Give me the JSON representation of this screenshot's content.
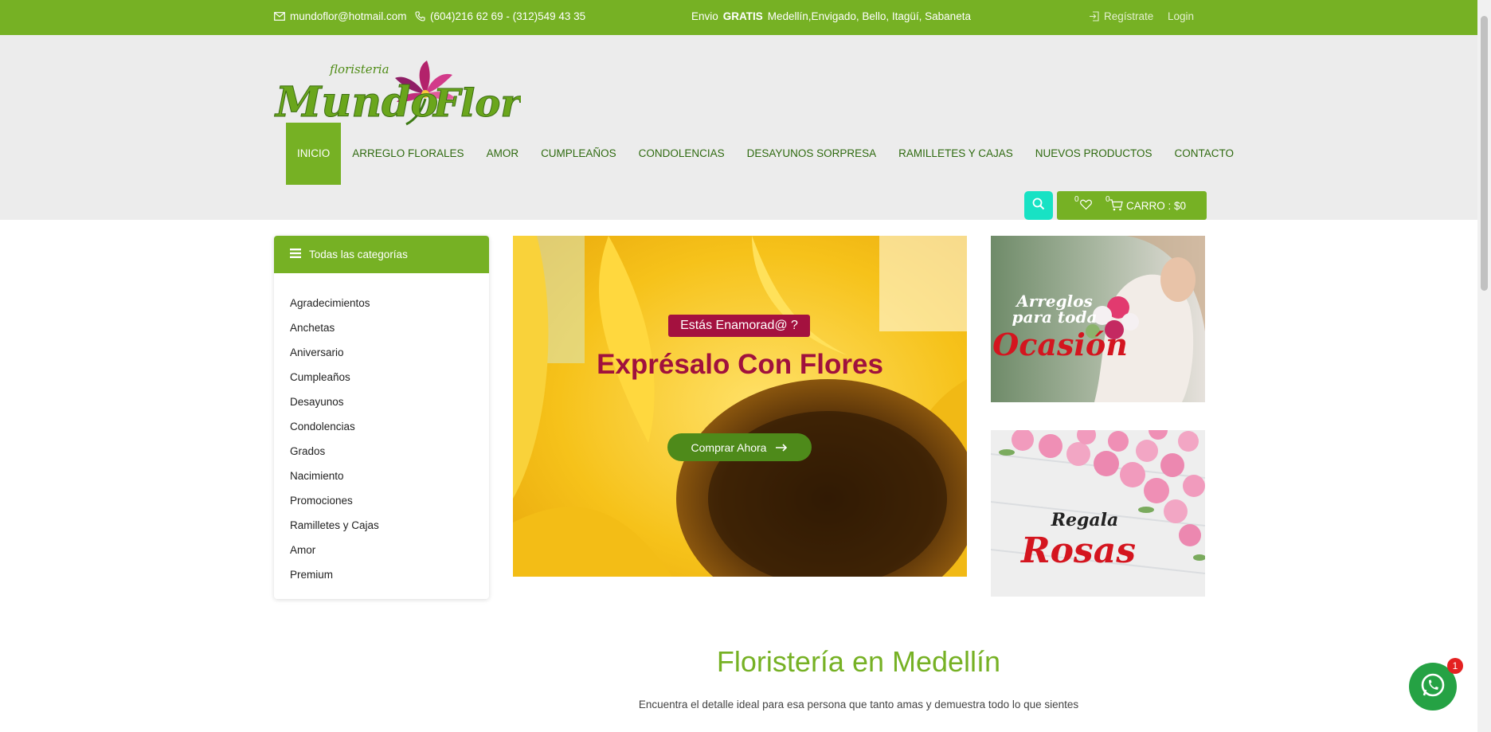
{
  "topbar": {
    "email": "mundoflor@hotmail.com",
    "phone": "(604)216 62 69 - (312)549 43 35",
    "promo_prefix": "Envio",
    "promo_bold": "GRATIS",
    "promo_rest": "Medellín,Envigado, Bello, Itagüí, Sabaneta",
    "register": "Regístrate",
    "login": "Login"
  },
  "logo": {
    "small_text": "floristeria",
    "main_text": "Mundo Flor"
  },
  "nav": {
    "items": [
      "INICIO",
      "ARREGLO FLORALES",
      "AMOR",
      "CUMPLEAÑOS",
      "CONDOLENCIAS",
      "DESAYUNOS SORPRESA",
      "RAMILLETES Y CAJAS",
      "NUEVOS PRODUCTOS",
      "CONTACTO"
    ],
    "active": "INICIO"
  },
  "cart": {
    "wishlist_count": "0",
    "cart_count": "0",
    "label": "CARRO : $0"
  },
  "sidebar": {
    "title": "Todas las categorías",
    "categories": [
      "Agradecimientos",
      "Anchetas",
      "Aniversario",
      "Cumpleaños",
      "Desayunos",
      "Condolencias",
      "Grados",
      "Nacimiento",
      "Promociones",
      "Ramilletes y Cajas",
      "Amor",
      "Premium"
    ]
  },
  "hero": {
    "tag": "Estás Enamorad@ ?",
    "title": "Exprésalo Con Flores",
    "cta": "Comprar Ahora"
  },
  "banners": {
    "top_line1": "Arreglos",
    "top_line2": "para toda",
    "top_line3": "Ocasión",
    "bottom_line1": "Regala",
    "bottom_line2": "Rosas"
  },
  "section": {
    "title": "Floristería en Medellín",
    "subtitle": "Encuentra el detalle ideal para esa persona que tanto amas y demuestra todo lo que sientes"
  },
  "whatsapp": {
    "badge": "1"
  },
  "colors": {
    "brand_green": "#76b124",
    "nav_text": "#2f6a10",
    "hero_red": "#a0113d",
    "search_teal": "#18e2c4"
  }
}
